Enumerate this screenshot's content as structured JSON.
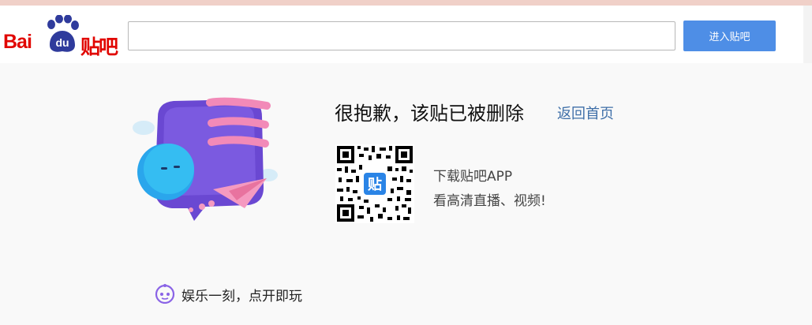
{
  "header": {
    "logo_bai": "Bai",
    "logo_du": "du",
    "logo_tieba": "贴吧",
    "search_placeholder": "",
    "enter_button_label": "进入贴吧"
  },
  "notice": {
    "title": "很抱歉，该贴已被删除",
    "home_link": "返回首页"
  },
  "app_promo": {
    "qr_badge": "贴",
    "line1": "下载贴吧APP",
    "line2": "看高清直播、视频!"
  },
  "footer": {
    "game_text": "娱乐一刻，点开即玩"
  },
  "colors": {
    "brand_red": "#e10601",
    "brand_blue": "#2f3b9c",
    "button_blue": "#4e8ee6",
    "link_blue": "#3f6fa8",
    "page_bg": "#f9f9f9"
  }
}
